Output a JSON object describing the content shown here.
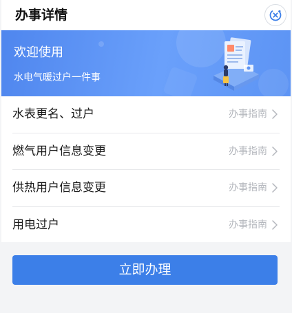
{
  "header": {
    "title": "办事详情",
    "close_icon": "close-circle-icon"
  },
  "banner": {
    "title": "欢迎使用",
    "subtitle": "水电气暖过户一件事",
    "illustration": "document-person-illustration"
  },
  "services": [
    {
      "label": "水表更名、过户",
      "guide": "办事指南"
    },
    {
      "label": "燃气用户信息变更",
      "guide": "办事指南"
    },
    {
      "label": "供热用户信息变更",
      "guide": "办事指南"
    },
    {
      "label": "用电过户",
      "guide": "办事指南"
    }
  ],
  "action": {
    "label": "立即办理"
  },
  "colors": {
    "accent": "#3c7fe8",
    "banner": "#5d94f4",
    "muted_text": "#b4b7bd"
  }
}
